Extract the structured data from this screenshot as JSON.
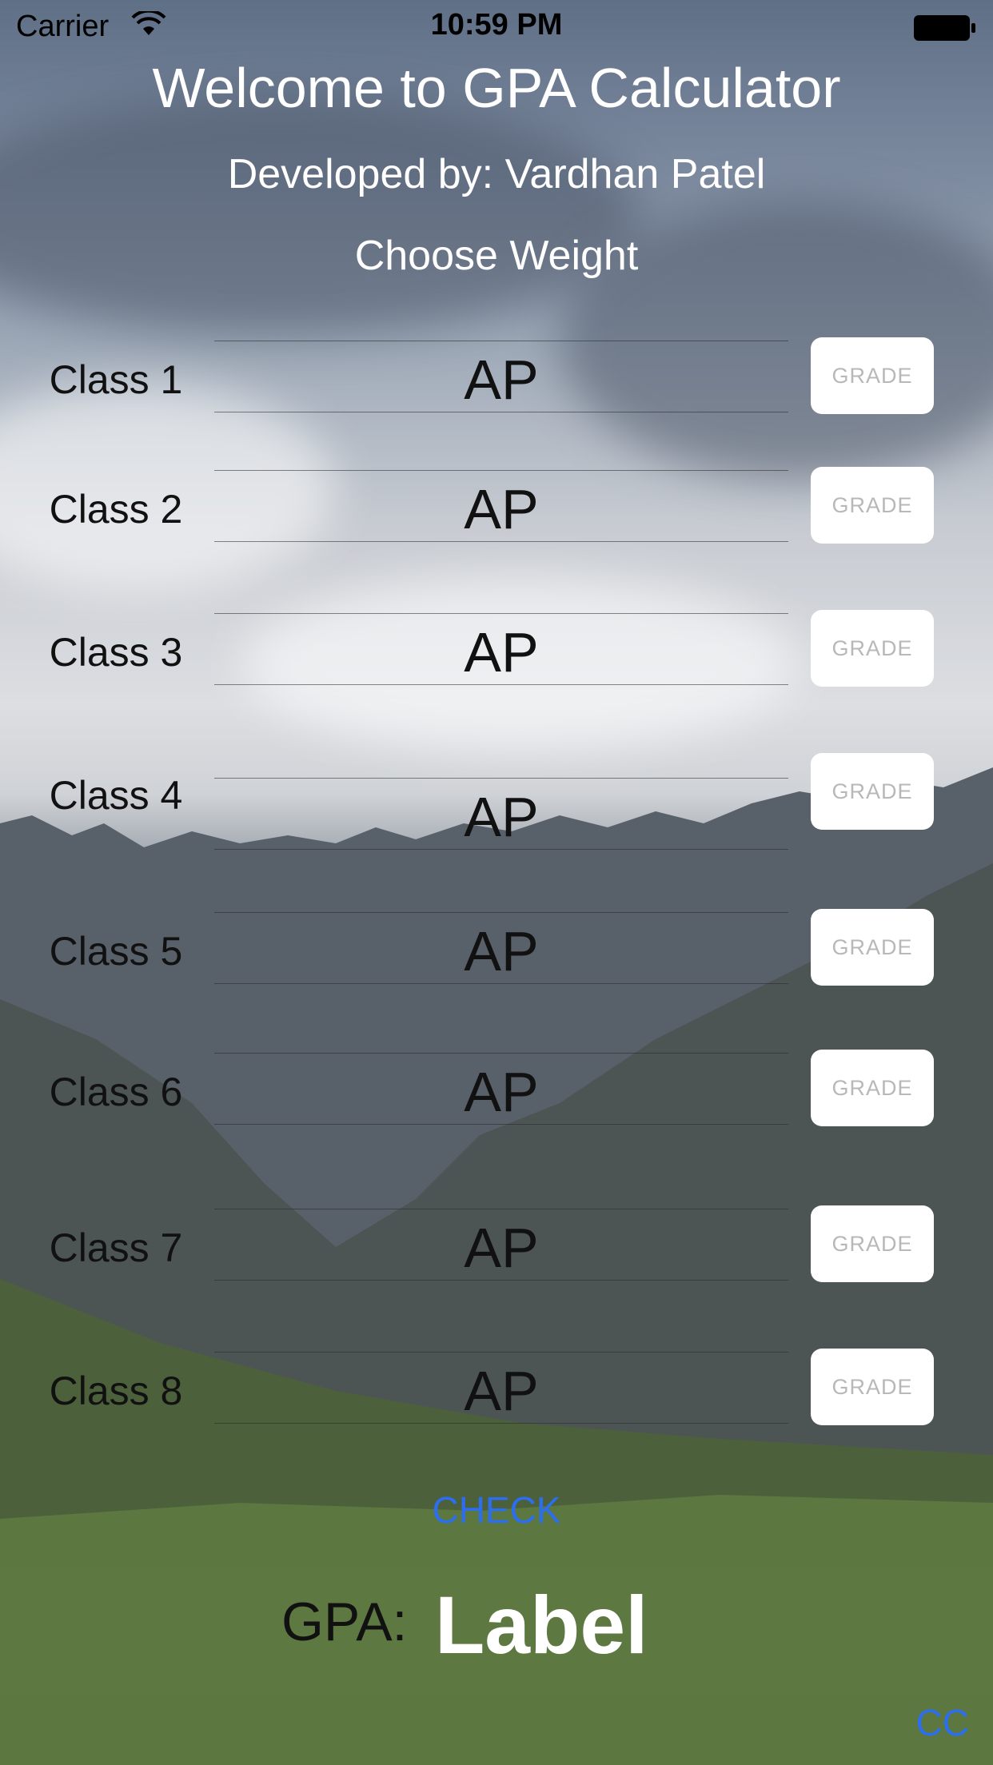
{
  "status": {
    "carrier": "Carrier",
    "time": "10:59 PM"
  },
  "header": {
    "title": "Welcome to GPA Calculator",
    "developer": "Developed by: Vardhan Patel",
    "weight_prompt": "Choose Weight"
  },
  "classes": [
    {
      "label": "Class 1",
      "weight": "AP",
      "grade_button": "GRADE"
    },
    {
      "label": "Class 2",
      "weight": "AP",
      "grade_button": "GRADE"
    },
    {
      "label": "Class 3",
      "weight": "AP",
      "grade_button": "GRADE"
    },
    {
      "label": "Class 4",
      "weight": "AP",
      "grade_button": "GRADE"
    },
    {
      "label": "Class 5",
      "weight": "AP",
      "grade_button": "GRADE"
    },
    {
      "label": "Class 6",
      "weight": "AP",
      "grade_button": "GRADE"
    },
    {
      "label": "Class 7",
      "weight": "AP",
      "grade_button": "GRADE"
    },
    {
      "label": "Class 8",
      "weight": "AP",
      "grade_button": "GRADE"
    }
  ],
  "footer": {
    "check_label": "CHECK",
    "gpa_label": "GPA:",
    "gpa_value": "Label",
    "cc_label": "CC"
  },
  "colors": {
    "accent": "#2c6ef0",
    "text_dark": "#111111",
    "text_light": "#ffffff"
  },
  "icons": [
    "wifi-icon",
    "battery-icon"
  ]
}
